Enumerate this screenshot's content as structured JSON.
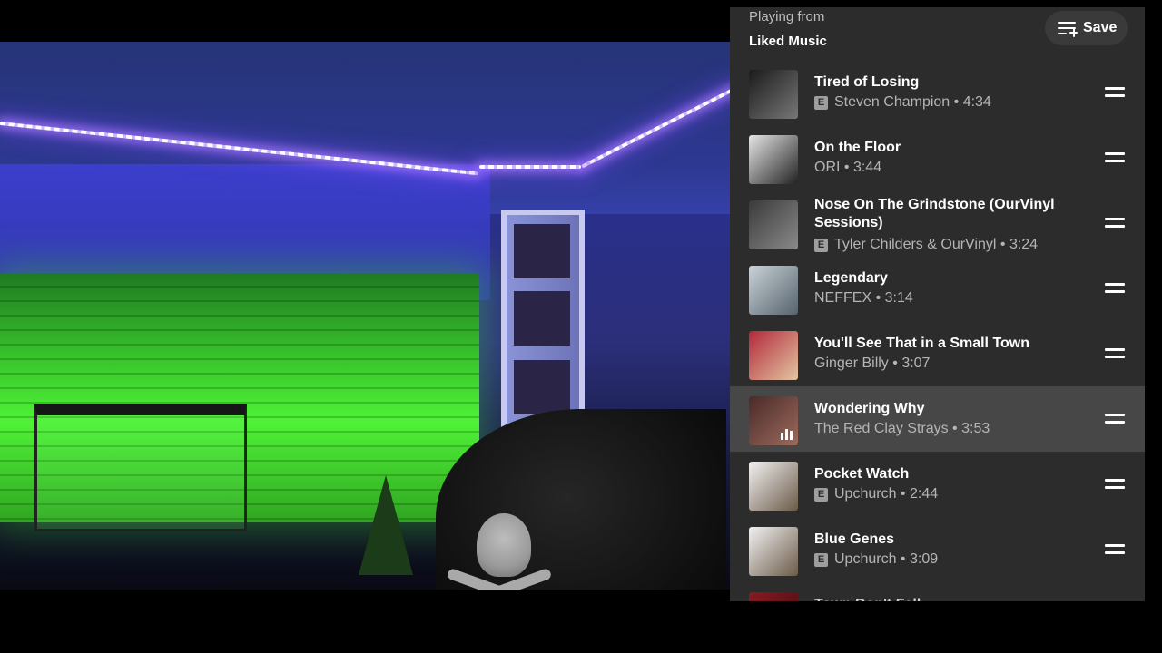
{
  "queue_panel": {
    "playing_from_label": "Playing from",
    "playlist_name": "Liked Music",
    "save_label": "Save",
    "tracks": [
      {
        "title": "Tired of Losing",
        "explicit": true,
        "artist": "Steven Champion",
        "duration": "4:34",
        "art_colors": [
          "#1b1b1b",
          "#777777"
        ]
      },
      {
        "title": "On the Floor",
        "explicit": false,
        "artist": "ORI",
        "duration": "3:44",
        "art_colors": [
          "#e6e6e6",
          "#222222"
        ]
      },
      {
        "title": "Nose On The Grindstone (OurVinyl Sessions)",
        "explicit": true,
        "artist": "Tyler Childers & OurVinyl",
        "duration": "3:24",
        "art_colors": [
          "#3a3a3a",
          "#8a8a8a"
        ]
      },
      {
        "title": "Legendary",
        "explicit": false,
        "artist": "NEFFEX",
        "duration": "3:14",
        "art_colors": [
          "#c9d2d8",
          "#56636d"
        ]
      },
      {
        "title": "You'll See That in a Small Town",
        "explicit": false,
        "artist": "Ginger Billy",
        "duration": "3:07",
        "art_colors": [
          "#b2283a",
          "#e3c6a2"
        ]
      },
      {
        "title": "Wondering Why",
        "explicit": false,
        "artist": "The Red Clay Strays",
        "duration": "3:53",
        "art_colors": [
          "#4a2a2a",
          "#9c6b5c"
        ],
        "now_playing": true
      },
      {
        "title": "Pocket Watch",
        "explicit": true,
        "artist": "Upchurch",
        "duration": "2:44",
        "art_colors": [
          "#f2f2f2",
          "#6b5a48"
        ]
      },
      {
        "title": "Blue Genes",
        "explicit": true,
        "artist": "Upchurch",
        "duration": "3:09",
        "art_colors": [
          "#f2f2f2",
          "#6b5a48"
        ]
      },
      {
        "title": "Town Don't Fall",
        "explicit": false,
        "artist": "",
        "duration": "",
        "art_colors": [
          "#8a1a22",
          "#3a0a10"
        ]
      }
    ]
  },
  "colors": {
    "panel_bg": "#2c2c2c",
    "active_row_bg": "#474747",
    "secondary_text": "#b5b5b5"
  },
  "icons": {
    "save": "playlist-add-icon",
    "drag": "drag-handle-icon",
    "explicit": "explicit-badge-icon",
    "now_playing": "equalizer-icon"
  },
  "explicit_badge_text": "E",
  "separator": " • "
}
